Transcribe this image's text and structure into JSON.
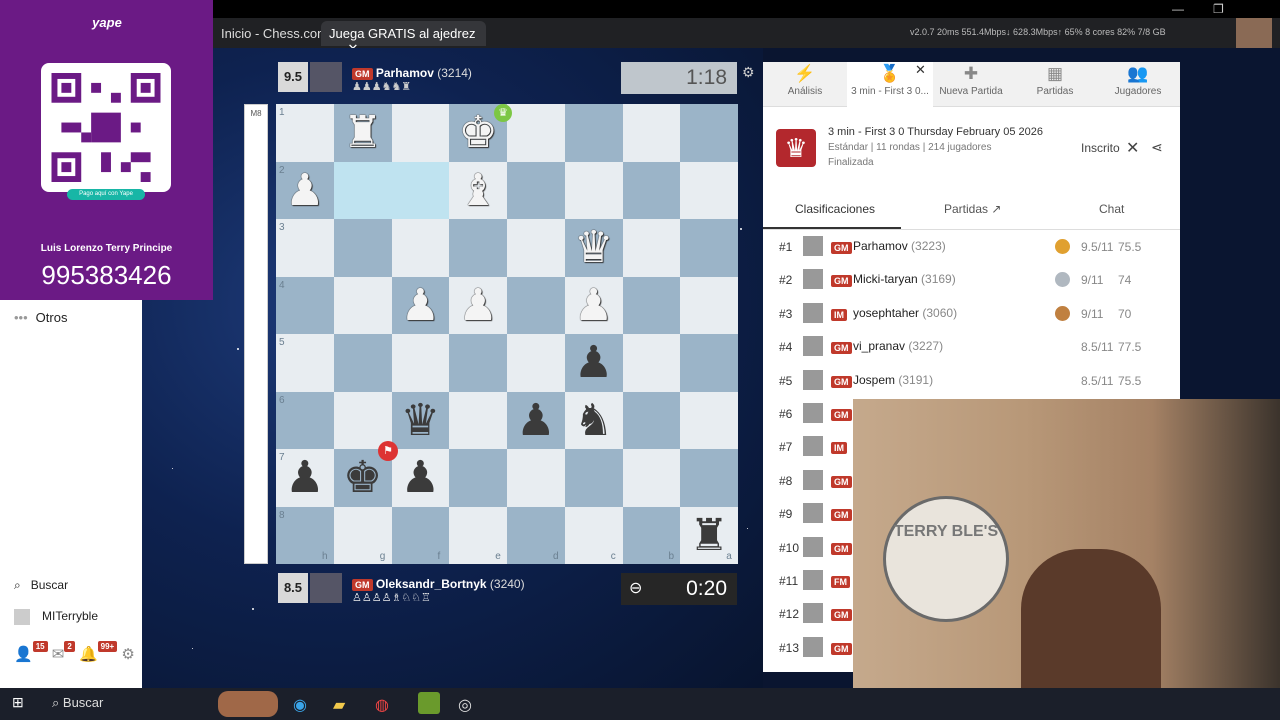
{
  "browser": {
    "tabs": [
      {
        "label": "Inicio - Chess.com"
      },
      {
        "label": "Juega GRATIS al ajedrez ..."
      }
    ],
    "sys_stats": "v2.0.7   20ms  551.4Mbps↓ 628.3Mbps↑   65%  8 cores   82%  7/8 GB"
  },
  "yape": {
    "logo": "yape",
    "qr_caption": "Pago aquí con Yape",
    "name": "Luis Lorenzo Terry Principe",
    "number": "995383426"
  },
  "sidebar": {
    "otros": "Otros",
    "search": "Buscar",
    "user": "MITerryble",
    "badges": {
      "friends": "15",
      "messages": "2",
      "notifications": "99+"
    }
  },
  "eval_label": "M8",
  "top_player": {
    "score": "9.5",
    "title": "GM",
    "name": "Parhamov",
    "rating": "(3214)",
    "clock": "1:18"
  },
  "bottom_player": {
    "score": "8.5",
    "title": "GM",
    "name": "Oleksandr_Bortnyk",
    "rating": "(3240)",
    "clock": "0:20"
  },
  "board": {
    "ranks": [
      "1",
      "2",
      "3",
      "4",
      "5",
      "6",
      "7",
      "8"
    ],
    "files": [
      "h",
      "g",
      "f",
      "e",
      "d",
      "c",
      "b",
      "a"
    ]
  },
  "panel": {
    "tabs": [
      {
        "label": "Análisis"
      },
      {
        "label": "3 min - First 3 0..."
      },
      {
        "label": "Nueva Partida"
      },
      {
        "label": "Partidas"
      },
      {
        "label": "Jugadores"
      }
    ],
    "event_title": "3 min - First 3 0 Thursday February 05 2026",
    "event_meta": "Estándar | 11 rondas | 214 jugadores",
    "event_status": "Finalizada",
    "registered": "Inscrito",
    "subtabs": [
      "Clasificaciones",
      "Partidas",
      "Chat"
    ],
    "standings": [
      {
        "pos": "#1",
        "title": "GM",
        "name": "Parhamov",
        "rating": "(3223)",
        "score": "9.5/11",
        "tb": "75.5",
        "medal": "#e0a030"
      },
      {
        "pos": "#2",
        "title": "GM",
        "name": "Micki-taryan",
        "rating": "(3169)",
        "score": "9/11",
        "tb": "74",
        "medal": "#b0b8c0"
      },
      {
        "pos": "#3",
        "title": "IM",
        "name": "yosephtaher",
        "rating": "(3060)",
        "score": "9/11",
        "tb": "70",
        "medal": "#c08040"
      },
      {
        "pos": "#4",
        "title": "GM",
        "name": "vi_pranav",
        "rating": "(3227)",
        "score": "8.5/11",
        "tb": "77.5",
        "medal": ""
      },
      {
        "pos": "#5",
        "title": "GM",
        "name": "Jospem",
        "rating": "(3191)",
        "score": "8.5/11",
        "tb": "75.5",
        "medal": ""
      },
      {
        "pos": "#6",
        "title": "GM"
      },
      {
        "pos": "#7",
        "title": "IM"
      },
      {
        "pos": "#8",
        "title": "GM"
      },
      {
        "pos": "#9",
        "title": "GM"
      },
      {
        "pos": "#10",
        "title": "GM"
      },
      {
        "pos": "#11",
        "title": "FM"
      },
      {
        "pos": "#12",
        "title": "GM"
      },
      {
        "pos": "#13",
        "title": "GM"
      }
    ]
  },
  "webcam_logo": "TERRY BLE'S",
  "taskbar": {
    "search": "Buscar"
  }
}
